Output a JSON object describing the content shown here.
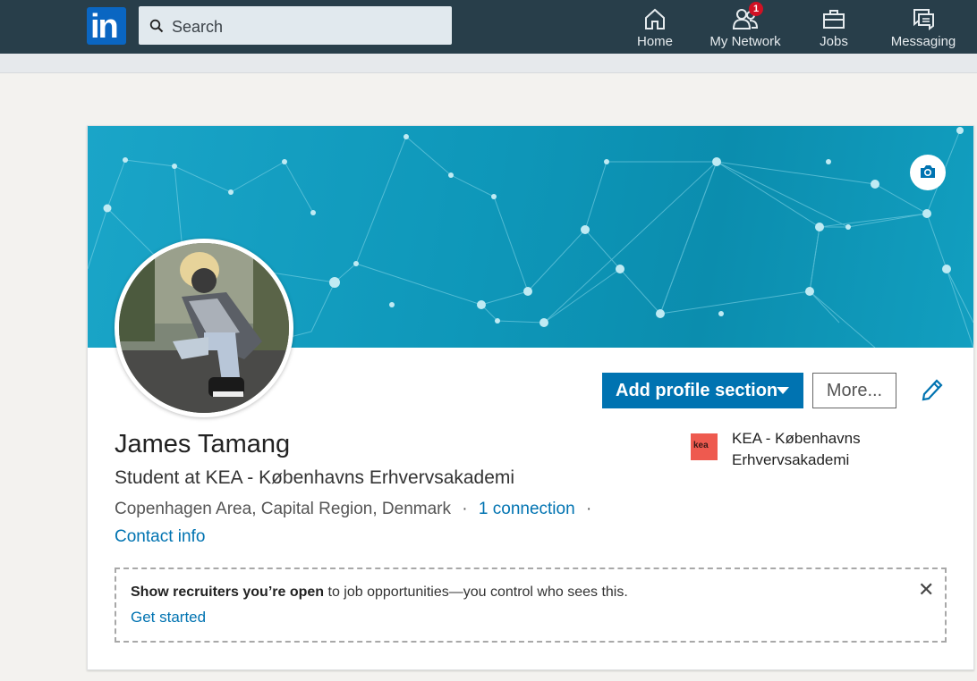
{
  "nav": {
    "logo_text": "in",
    "search_placeholder": "Search",
    "items": [
      {
        "label": "Home",
        "icon": "home-icon"
      },
      {
        "label": "My Network",
        "icon": "network-icon",
        "badge": "1"
      },
      {
        "label": "Jobs",
        "icon": "briefcase-icon"
      },
      {
        "label": "Messaging",
        "icon": "messaging-icon"
      }
    ]
  },
  "profile": {
    "name": "James Tamang",
    "headline": "Student at KEA - Københavns Erhvervsakademi",
    "location": "Copenhagen Area, Capital Region, Denmark",
    "separator": "·",
    "connections": "1 connection",
    "contact_info": "Contact info",
    "add_section_label": "Add profile section",
    "more_label": "More...",
    "school": {
      "logo_text": "kea",
      "name": "KEA - Københavns Erhvervsakademi"
    }
  },
  "open_to_work": {
    "bold_text": "Show recruiters you’re open",
    "rest_text": " to job opportunities—you control who sees this.",
    "cta": "Get started",
    "close": "✕"
  },
  "colors": {
    "nav_bg": "#283e4a",
    "brand_blue": "#0073b1",
    "banner_teal": "#0e97b9",
    "badge_red": "#d11124"
  }
}
